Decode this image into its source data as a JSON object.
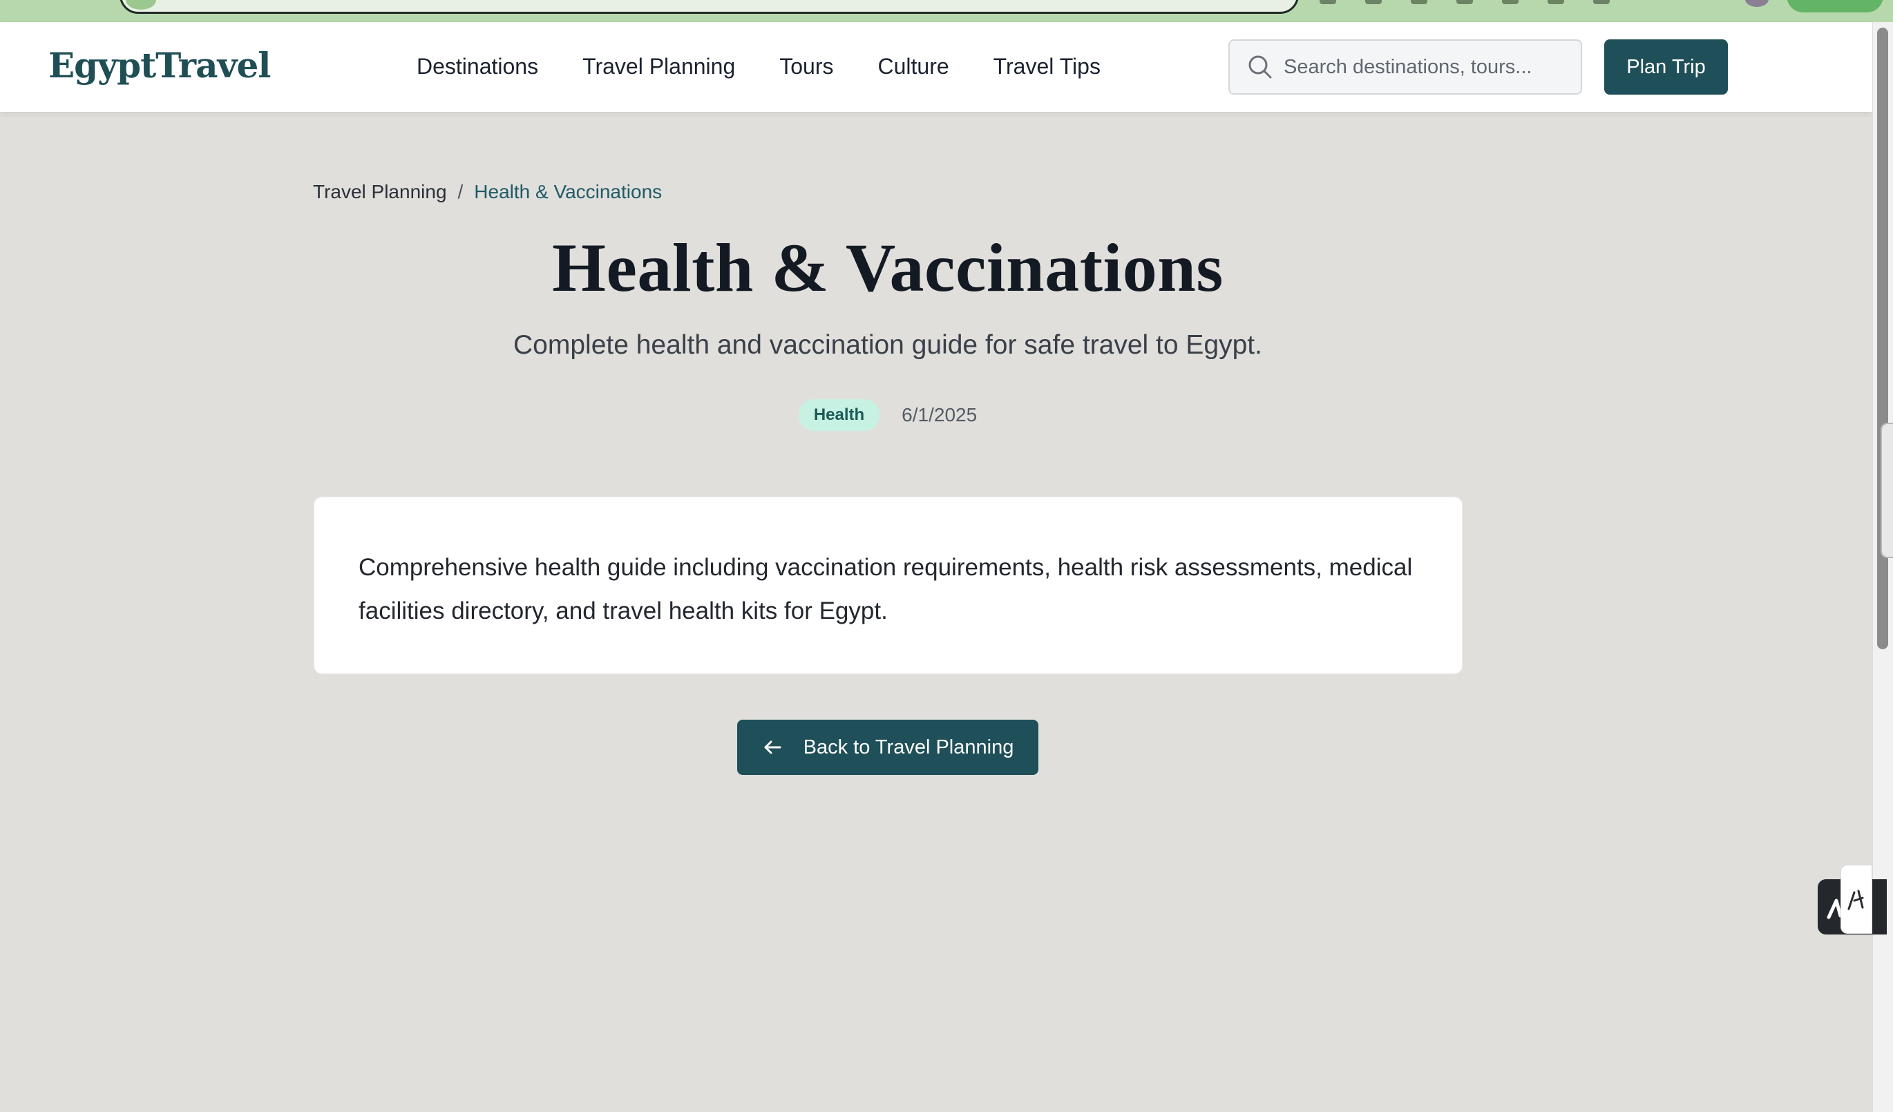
{
  "site": {
    "logo": "EgyptTravel"
  },
  "nav": {
    "items": [
      {
        "label": "Destinations"
      },
      {
        "label": "Travel Planning"
      },
      {
        "label": "Tours"
      },
      {
        "label": "Culture"
      },
      {
        "label": "Travel Tips"
      }
    ]
  },
  "search": {
    "placeholder": "Search destinations, tours..."
  },
  "header": {
    "plan_trip_label": "Plan Trip"
  },
  "breadcrumb": {
    "parent": "Travel Planning",
    "separator": "/",
    "current": "Health & Vaccinations"
  },
  "article": {
    "title": "Health & Vaccinations",
    "subtitle": "Complete health and vaccination guide for safe travel to Egypt.",
    "tag": "Health",
    "date": "6/1/2025",
    "body": "Comprehensive health guide including vaccination requirements, health risk assessments, medical facilities directory, and travel health kits for Egypt."
  },
  "actions": {
    "back_label": "Back to Travel Planning"
  },
  "colors": {
    "brand": "#1f4f58",
    "page_background": "#e0dfdc",
    "tag_background": "#c7f2e3",
    "tag_text": "#1d5b55",
    "browser_chrome": "#b7d7ad"
  },
  "icons": {
    "search": "search-icon",
    "back": "arrow-left-icon",
    "widget": "signature-icon"
  }
}
